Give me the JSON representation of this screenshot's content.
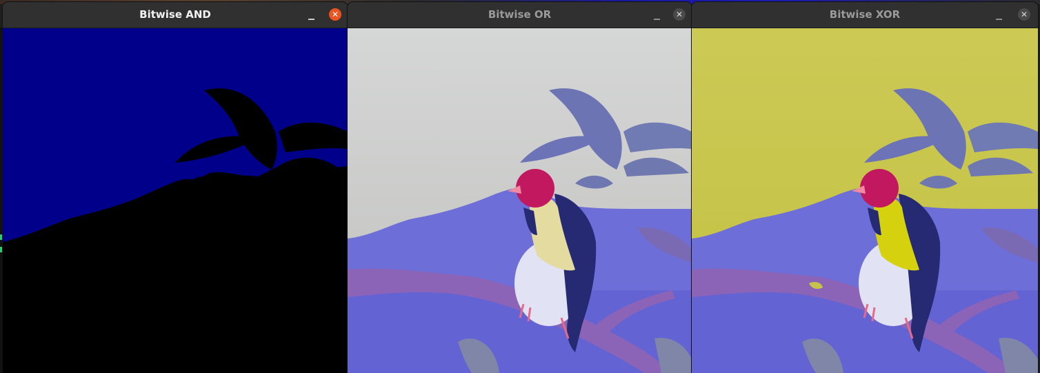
{
  "windows": [
    {
      "title": "Bitwise AND",
      "minimize_label": "–",
      "close_label": "✕",
      "state": "active"
    },
    {
      "title": "Bitwise OR",
      "minimize_label": "–",
      "close_label": "✕",
      "state": "inactive"
    },
    {
      "title": "Bitwise XOR",
      "minimize_label": "–",
      "close_label": "✕",
      "state": "inactive"
    }
  ],
  "colors": {
    "titlebar": "#303030",
    "close_active": "#e95420",
    "and_background": "#00008b",
    "or_sky": "#d2d3d3",
    "xor_sky": "#c8c64a",
    "blue_overlay": "#6a6ad6"
  },
  "icons": [
    "minimize-icon",
    "close-icon"
  ]
}
